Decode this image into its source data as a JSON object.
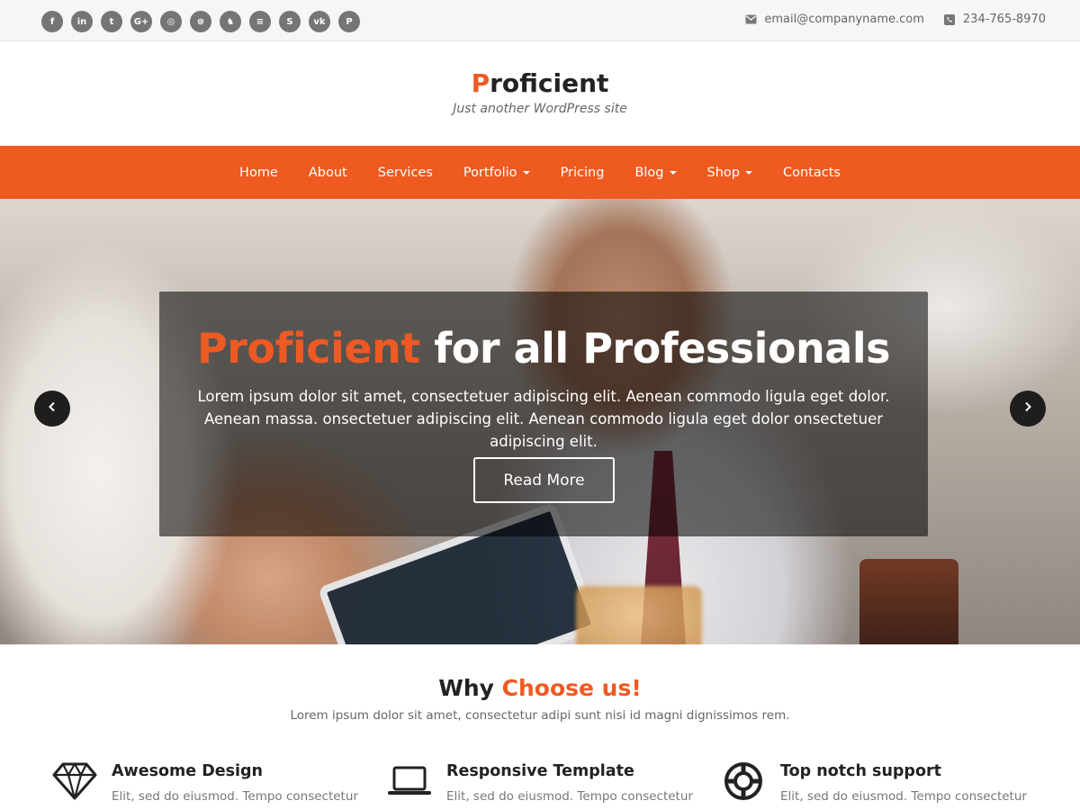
{
  "social_icons": [
    {
      "name": "facebook",
      "glyph": "f"
    },
    {
      "name": "linkedin",
      "glyph": "in"
    },
    {
      "name": "twitter",
      "glyph": "t"
    },
    {
      "name": "google-plus",
      "glyph": "G+"
    },
    {
      "name": "instagram",
      "glyph": "◎"
    },
    {
      "name": "dribbble",
      "glyph": "⊛"
    },
    {
      "name": "github",
      "glyph": "♞"
    },
    {
      "name": "stack-exchange",
      "glyph": "≡"
    },
    {
      "name": "skype",
      "glyph": "S"
    },
    {
      "name": "vk",
      "glyph": "vk"
    },
    {
      "name": "pinterest",
      "glyph": "P"
    }
  ],
  "contact": {
    "email": "email@companyname.com",
    "phone": "234-765-8970"
  },
  "brand": {
    "title_first": "P",
    "title_rest": "roficient",
    "tagline": "Just another WordPress site"
  },
  "nav": {
    "items": [
      {
        "label": "Home",
        "dropdown": false
      },
      {
        "label": "About",
        "dropdown": false
      },
      {
        "label": "Services",
        "dropdown": false
      },
      {
        "label": "Portfolio",
        "dropdown": true
      },
      {
        "label": "Pricing",
        "dropdown": false
      },
      {
        "label": "Blog",
        "dropdown": true
      },
      {
        "label": "Shop",
        "dropdown": true
      },
      {
        "label": "Contacts",
        "dropdown": false
      }
    ]
  },
  "hero": {
    "headline_highlight": "Proficient",
    "headline_rest": " for all Professionals",
    "description": "Lorem ipsum dolor sit amet, consectetuer adipiscing elit. Aenean commodo ligula eget dolor. Aenean massa. onsectetuer adipiscing elit. Aenean commodo ligula eget dolor onsectetuer adipiscing elit.",
    "button_label": "Read More"
  },
  "why": {
    "title_plain": "Why ",
    "title_highlight": "Choose us!",
    "subtitle": "Lorem ipsum dolor sit amet, consectetur adipi sunt nisi id magni dignissimos rem.",
    "features": [
      {
        "icon": "diamond-icon",
        "title": "Awesome Design",
        "text": "Elit, sed do eiusmod. Tempo consectetur"
      },
      {
        "icon": "laptop-icon",
        "title": "Responsive Template",
        "text": "Elit, sed do eiusmod. Tempo consectetur"
      },
      {
        "icon": "lifebuoy-icon",
        "title": "Top notch support",
        "text": "Elit, sed do eiusmod. Tempo consectetur"
      }
    ]
  },
  "colors": {
    "accent": "#ee5a24",
    "nav_bg": "#ee5a20",
    "topbar_bg": "#f6f6f6",
    "social_icon_bg": "#757575"
  }
}
